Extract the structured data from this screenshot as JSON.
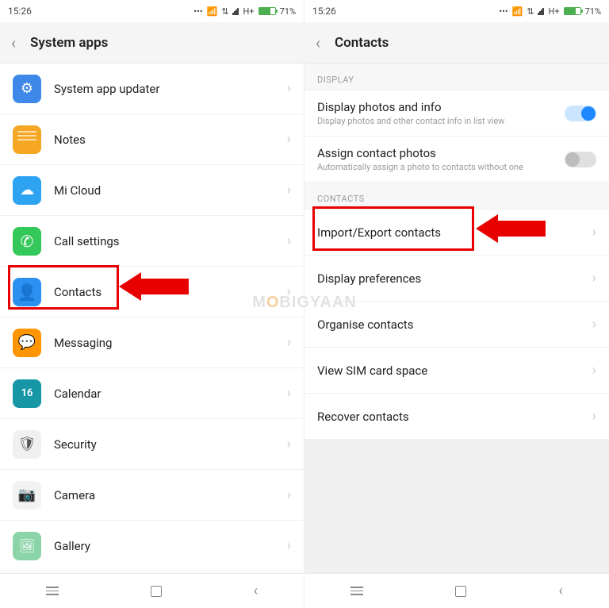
{
  "status": {
    "time": "15:26",
    "net": "H+",
    "battery_pct": "71%"
  },
  "left": {
    "title": "System apps",
    "rows": [
      {
        "icon": "gear-icon",
        "label": "System app updater"
      },
      {
        "icon": "notes-icon",
        "label": "Notes"
      },
      {
        "icon": "cloud-icon",
        "label": "Mi Cloud"
      },
      {
        "icon": "phone-icon",
        "label": "Call settings"
      },
      {
        "icon": "person-icon",
        "label": "Contacts"
      },
      {
        "icon": "chat-icon",
        "label": "Messaging"
      },
      {
        "icon": "calendar-icon",
        "label": "Calendar"
      },
      {
        "icon": "shield-icon",
        "label": "Security"
      },
      {
        "icon": "camera-icon",
        "label": "Camera"
      },
      {
        "icon": "gallery-icon",
        "label": "Gallery"
      }
    ]
  },
  "right": {
    "title": "Contacts",
    "section_display": "DISPLAY",
    "display_rows": [
      {
        "title": "Display photos and info",
        "sub": "Display photos and other contact info in list view",
        "toggle": "on"
      },
      {
        "title": "Assign contact photos",
        "sub": "Automatically assign a photo to contacts without one",
        "toggle": "off"
      }
    ],
    "section_contacts": "CONTACTS",
    "contact_rows": [
      {
        "title": "Import/Export contacts"
      },
      {
        "title": "Display preferences"
      },
      {
        "title": "Organise contacts"
      },
      {
        "title": "View SIM card space"
      },
      {
        "title": "Recover contacts"
      }
    ]
  },
  "watermark_parts": {
    "a": "M",
    "b": "O",
    "c": "BIGYAAN"
  }
}
